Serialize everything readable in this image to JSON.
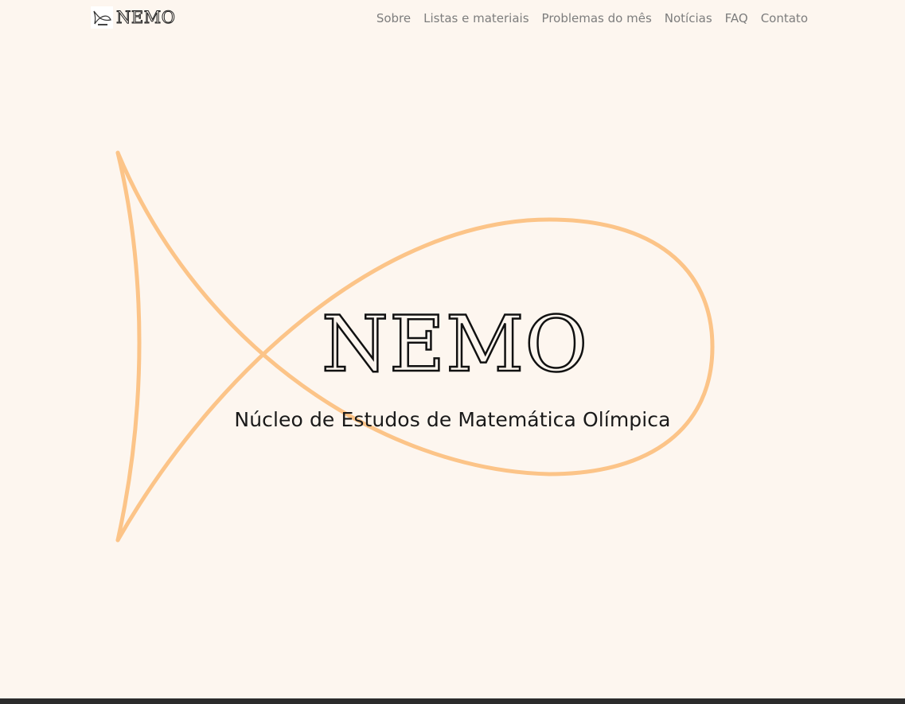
{
  "brand": {
    "name": "NEMO",
    "logo_icon": "fish-logo-icon"
  },
  "nav": {
    "items": [
      {
        "label": "Sobre"
      },
      {
        "label": "Listas e materiais"
      },
      {
        "label": "Problemas do mês"
      },
      {
        "label": "Notícias"
      },
      {
        "label": "FAQ"
      },
      {
        "label": "Contato"
      }
    ]
  },
  "hero": {
    "title": "NEMO",
    "subtitle": "Núcleo de Estudos de Matemática Olímpica",
    "fish_icon": "fish-outline-icon"
  },
  "colors": {
    "background": "#fdf6ef",
    "fish_stroke": "#fcc488",
    "nav_text": "#7d7d7d",
    "title_text": "#111111"
  }
}
